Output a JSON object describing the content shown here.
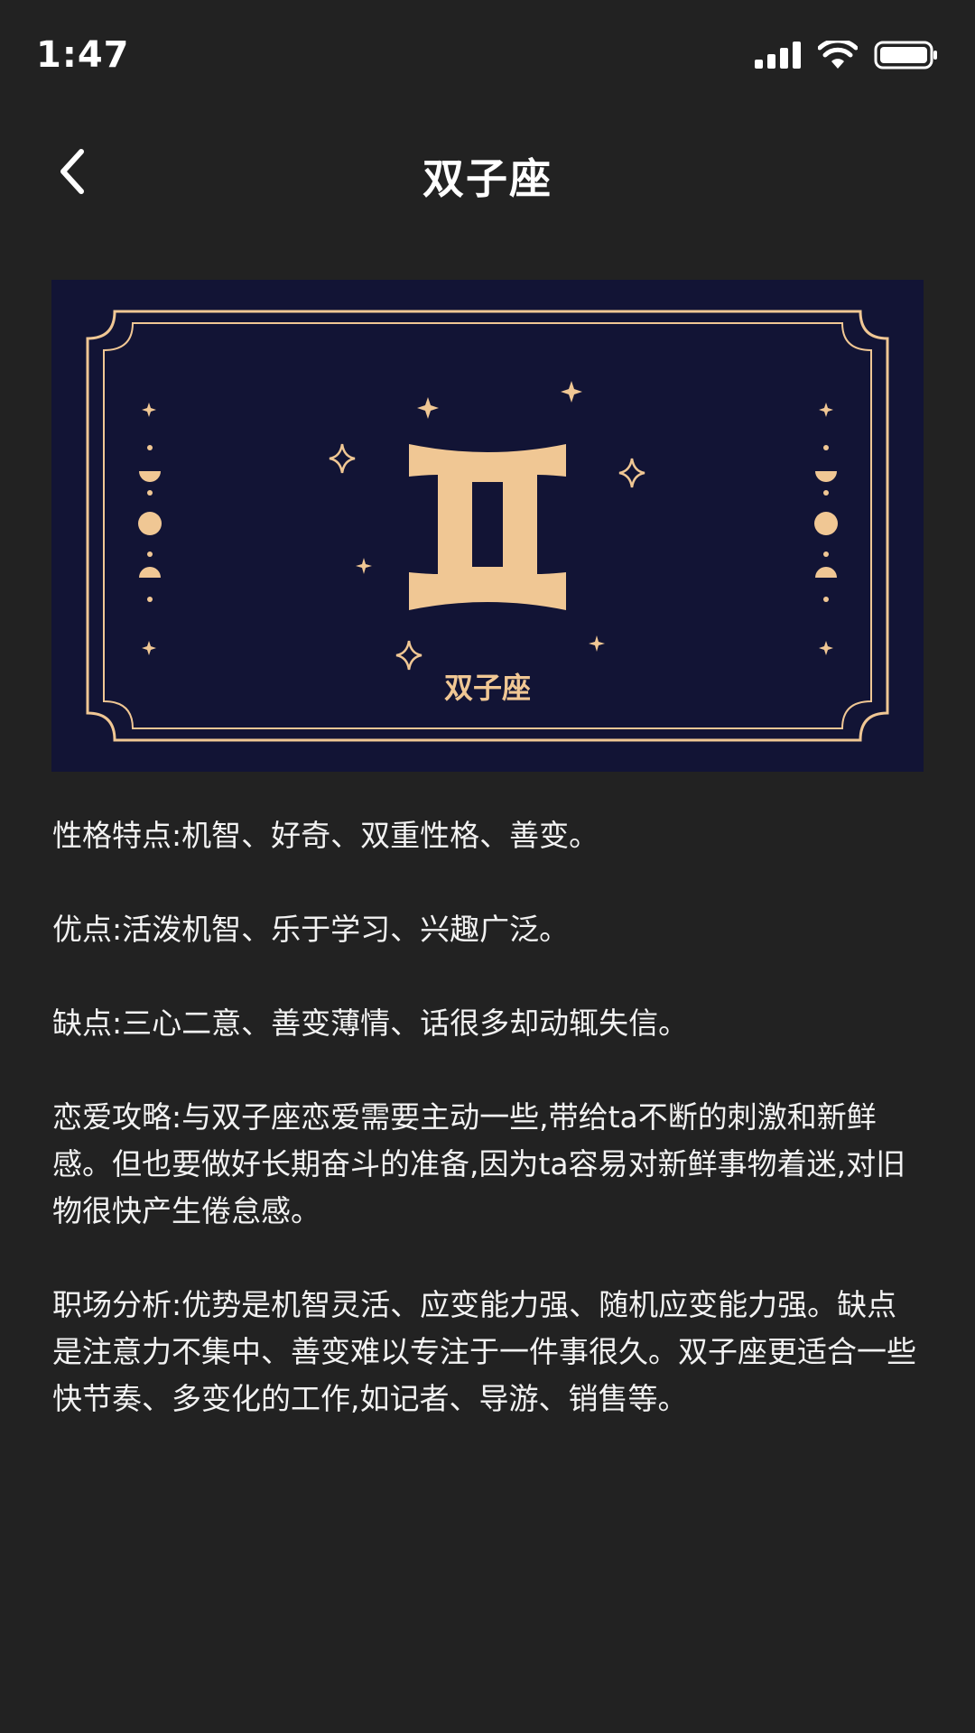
{
  "status_bar": {
    "time": "1:47",
    "icons": [
      "signal-icon",
      "wifi-icon",
      "battery-icon"
    ]
  },
  "nav": {
    "back_icon": "chevron-left-icon",
    "title": "双子座"
  },
  "banner": {
    "symbol": "gemini-symbol",
    "label": "双子座",
    "background_color": "#121435",
    "accent_color": "#F0C794"
  },
  "sections": [
    {
      "text": "性格特点:机智、好奇、双重性格、善变。"
    },
    {
      "text": "优点:活泼机智、乐于学习、兴趣广泛。"
    },
    {
      "text": "缺点:三心二意、善变薄情、话很多却动辄失信。"
    },
    {
      "text": "恋爱攻略:与双子座恋爱需要主动一些,带给ta不断的刺激和新鲜感。但也要做好长期奋斗的准备,因为ta容易对新鲜事物着迷,对旧物很快产生倦怠感。"
    },
    {
      "text": "职场分析:优势是机智灵活、应变能力强、随机应变能力强。缺点是注意力不集中、善变难以专注于一件事很久。双子座更适合一些快节奏、多变化的工作,如记者、导游、销售等。"
    }
  ]
}
